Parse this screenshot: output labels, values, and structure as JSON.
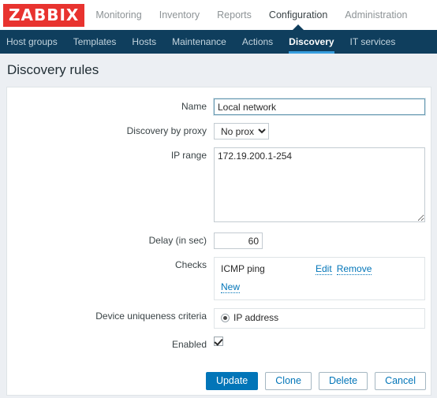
{
  "header": {
    "logo_text": "ZABBIX",
    "logo_color": "#e8332f",
    "nav": [
      {
        "label": "Monitoring",
        "active": false
      },
      {
        "label": "Inventory",
        "active": false
      },
      {
        "label": "Reports",
        "active": false
      },
      {
        "label": "Configuration",
        "active": true
      },
      {
        "label": "Administration",
        "active": false
      }
    ]
  },
  "subnav": {
    "background": "#0f3e5d",
    "active_underline": "#389ede",
    "items": [
      {
        "label": "Host groups",
        "active": false
      },
      {
        "label": "Templates",
        "active": false
      },
      {
        "label": "Hosts",
        "active": false
      },
      {
        "label": "Maintenance",
        "active": false
      },
      {
        "label": "Actions",
        "active": false
      },
      {
        "label": "Discovery",
        "active": true
      },
      {
        "label": "IT services",
        "active": false
      }
    ]
  },
  "page": {
    "title": "Discovery rules"
  },
  "form": {
    "name": {
      "label": "Name",
      "value": "Local network",
      "placeholder": "",
      "focused": true
    },
    "proxy": {
      "label": "Discovery by proxy",
      "selected": "No proxy",
      "options": [
        "No proxy"
      ]
    },
    "ip_range": {
      "label": "IP range",
      "value": "172.19.200.1-254",
      "placeholder": ""
    },
    "delay": {
      "label": "Delay (in sec)",
      "value": "60",
      "placeholder": ""
    },
    "checks": {
      "label": "Checks",
      "items": [
        {
          "name": "ICMP ping",
          "edit_label": "Edit",
          "remove_label": "Remove"
        }
      ],
      "new_label": "New"
    },
    "uniqueness": {
      "label": "Device uniqueness criteria",
      "options": [
        {
          "label": "IP address",
          "selected": true
        }
      ]
    },
    "enabled": {
      "label": "Enabled",
      "checked": true
    }
  },
  "buttons": {
    "update": "Update",
    "clone": "Clone",
    "delete": "Delete",
    "cancel": "Cancel",
    "primary_color": "#0275b8"
  }
}
